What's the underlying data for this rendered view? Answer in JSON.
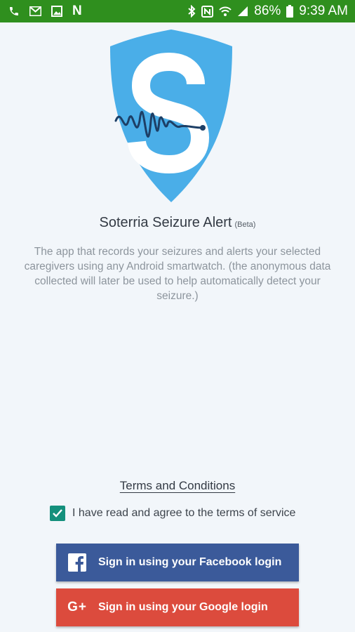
{
  "status_bar": {
    "battery": "86%",
    "time": "9:39 AM",
    "left_icons": [
      "phone-icon",
      "gmail-icon",
      "image-icon",
      "n-icon"
    ],
    "right_icons": [
      "bluetooth-icon",
      "nfc-icon",
      "wifi-icon",
      "signal-icon",
      "battery-icon"
    ],
    "n_glyph": "N",
    "color": "#2f8f1e"
  },
  "app": {
    "title": "Soterria Seizure Alert",
    "beta": "(Beta)",
    "description": "The app that records your seizures and alerts your selected caregivers using any Android smartwatch. (the anonymous data collected will later be used to help automatically detect your seizure.)",
    "logo_icon": "shield-wave-logo-icon",
    "logo_color": "#4aaee8"
  },
  "terms": {
    "link_label": "Terms and Conditions",
    "agree_label": "I have read and agree to the terms of service",
    "agree_checked": true,
    "checkbox_color": "#14907c"
  },
  "buttons": {
    "facebook_label": "Sign in using your Facebook login",
    "facebook_color": "#3b5a9a",
    "google_label": "Sign in using your Google login",
    "google_icon_text": "G+",
    "google_color": "#dc4b3d"
  }
}
